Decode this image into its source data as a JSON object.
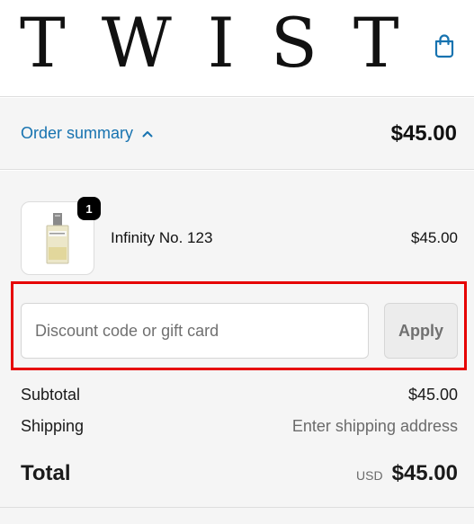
{
  "header": {
    "logo_text": "TWIST",
    "cart_icon": "shopping-bag-icon"
  },
  "summary": {
    "toggle_label": "Order summary",
    "toggle_icon": "chevron-up-icon",
    "total": "$45.00"
  },
  "line_items": [
    {
      "name": "Infinity No. 123",
      "price": "$45.00",
      "quantity": "1",
      "image_icon": "perfume-bottle-icon"
    }
  ],
  "discount": {
    "placeholder": "Discount code or gift card",
    "value": "",
    "apply_label": "Apply"
  },
  "totals": {
    "subtotal_label": "Subtotal",
    "subtotal_value": "$45.00",
    "shipping_label": "Shipping",
    "shipping_value": "Enter shipping address",
    "total_label": "Total",
    "currency": "USD",
    "total_value": "$45.00"
  },
  "colors": {
    "accent": "#1773b0",
    "highlight": "#e60000",
    "panel": "#f5f5f5"
  }
}
